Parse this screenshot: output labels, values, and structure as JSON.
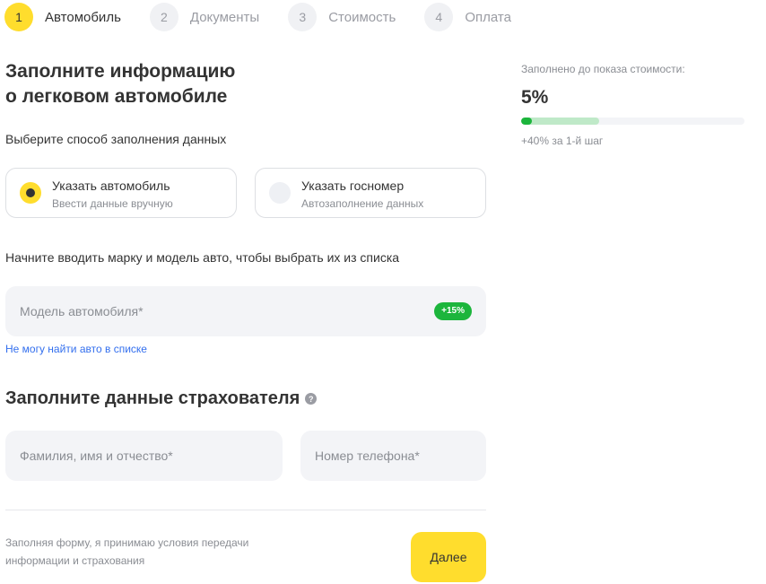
{
  "stepper": {
    "steps": [
      {
        "num": "1",
        "label": "Автомобиль",
        "active": true
      },
      {
        "num": "2",
        "label": "Документы",
        "active": false
      },
      {
        "num": "3",
        "label": "Стоимость",
        "active": false
      },
      {
        "num": "4",
        "label": "Оплата",
        "active": false
      }
    ]
  },
  "form": {
    "title_line1": "Заполните информацию",
    "title_line2": "о легковом автомобиле",
    "fill_method_prompt": "Выберите способ заполнения данных",
    "options": [
      {
        "title": "Указать автомобиль",
        "subtitle": "Ввести данные вручную",
        "selected": true
      },
      {
        "title": "Указать госномер",
        "subtitle": "Автозаполнение данных",
        "selected": false
      }
    ],
    "model_hint": "Начните вводить марку и модель авто, чтобы выбрать их из списка",
    "model_placeholder": "Модель автомобиля*",
    "model_bonus": "+15%",
    "cant_find_link": "Не могу найти авто в списке",
    "insurer_heading": "Заполните данные страхователя",
    "fio_placeholder": "Фамилия, имя и отчество*",
    "phone_placeholder": "Номер телефона*",
    "consent_line1": "Заполняя форму, я принимаю условия передачи",
    "consent_line2": "информации и страхования",
    "next_button": "Далее"
  },
  "progress": {
    "label": "Заполнено до показа стоимости:",
    "value_text": "5%",
    "value_fraction": 0.05,
    "next_step_fraction": 0.35,
    "hint": "+40% за 1-й шаг"
  },
  "colors": {
    "accent_yellow": "#ffdd2d",
    "badge_green": "#1cb53c",
    "link_blue": "#336fee"
  }
}
